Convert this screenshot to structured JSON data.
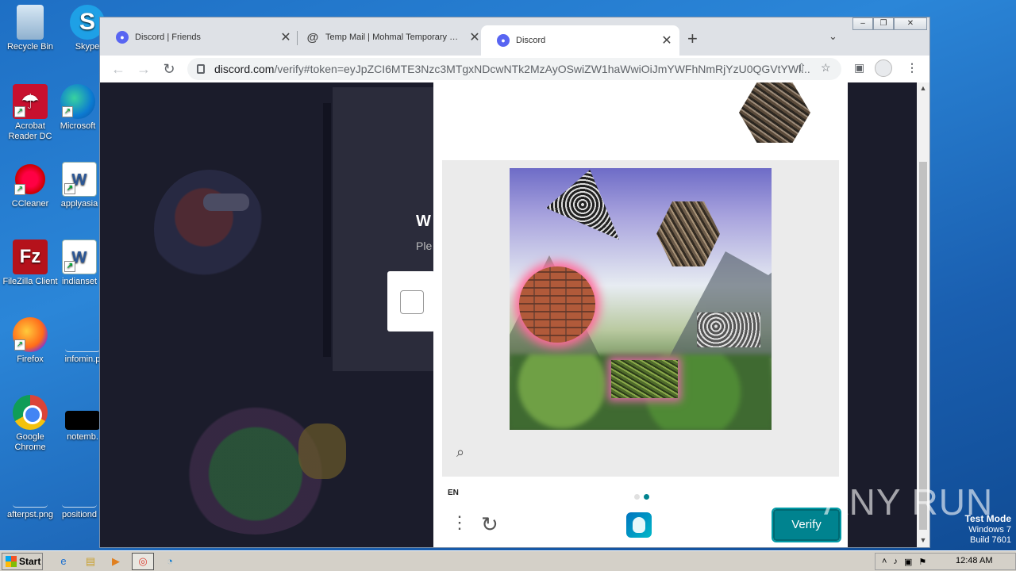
{
  "desktop": {
    "icons": [
      {
        "label": "Recycle Bin",
        "icon": "recycle-bin-icon"
      },
      {
        "label": "Skype",
        "icon": "skype-icon"
      },
      {
        "label": "Acrobat Reader DC",
        "icon": "acrobat-icon"
      },
      {
        "label": "Microsoft",
        "icon": "edge-icon"
      },
      {
        "label": "CCleaner",
        "icon": "ccleaner-icon"
      },
      {
        "label": "applyasia",
        "icon": "word-doc-icon"
      },
      {
        "label": "FileZilla Client",
        "icon": "filezilla-icon"
      },
      {
        "label": "indianset",
        "icon": "word-doc-icon"
      },
      {
        "label": "Firefox",
        "icon": "firefox-icon"
      },
      {
        "label": "infomin.p",
        "icon": "file-icon"
      },
      {
        "label": "Google Chrome",
        "icon": "chrome-icon"
      },
      {
        "label": "notemb.",
        "icon": "file-icon"
      },
      {
        "label": "afterpst.png",
        "icon": "image-file-icon"
      },
      {
        "label": "positiond",
        "icon": "file-icon"
      }
    ]
  },
  "browser": {
    "tabs": [
      {
        "title": "Discord | Friends",
        "active": false
      },
      {
        "title": "Temp Mail | Mohmal Temporary Dispo",
        "active": false
      },
      {
        "title": "Discord",
        "active": true
      }
    ],
    "url_host": "discord.com",
    "url_path": "/verify#token=eyJpZCI6MTE3Nzc3MTgxNDcwNTk2MzAyOSwiZW1haWwiOiJmYWFhNmRjYzU0QGVtYWl..."
  },
  "discord_bg": {
    "heading": "W",
    "sub": "Ple"
  },
  "captcha": {
    "language": "EN",
    "verify_label": "Verify",
    "active_page": 2
  },
  "taskbar": {
    "start_label": "Start",
    "clock": "12:48 AM"
  },
  "overlay": {
    "watermark": "ANY RUN",
    "testmode_line1": "Test Mode",
    "testmode_line2": "Windows 7",
    "testmode_line3": "Build 7601"
  }
}
